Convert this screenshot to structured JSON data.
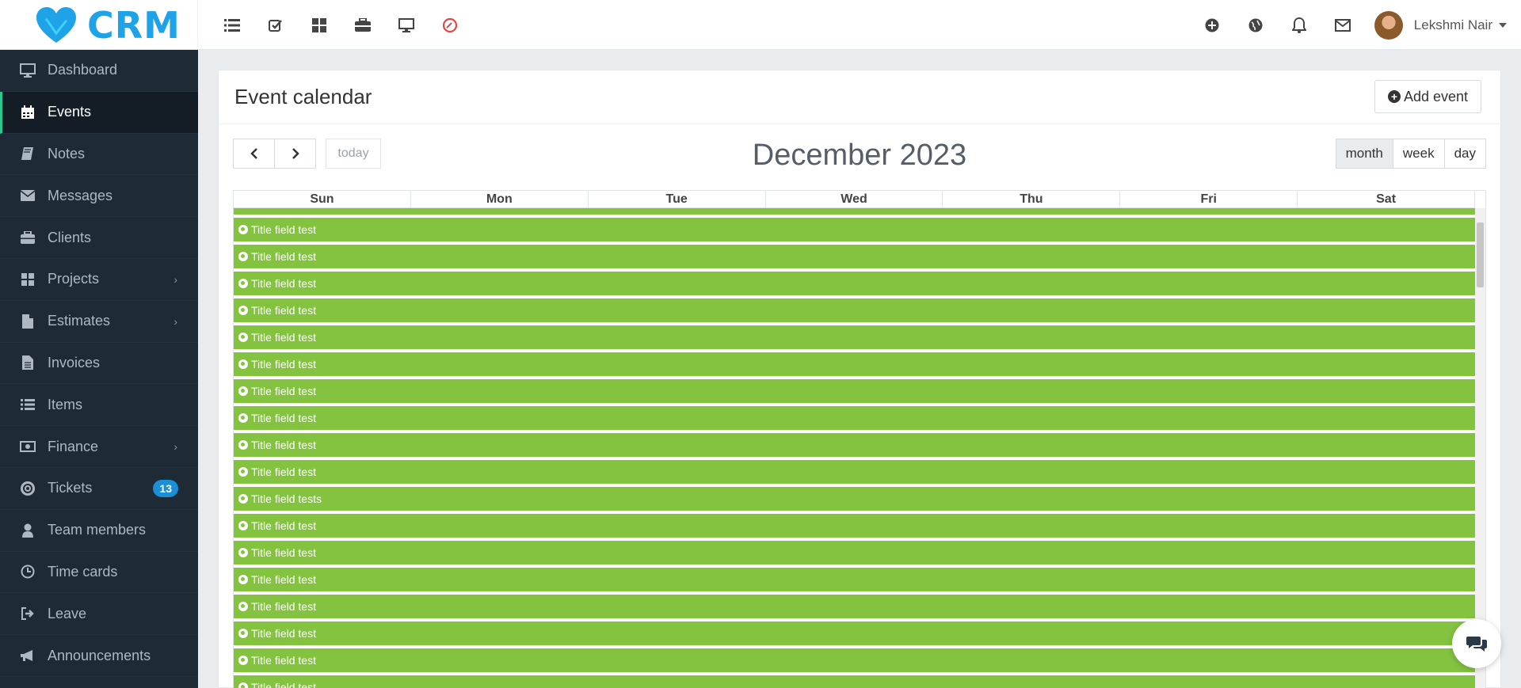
{
  "app": {
    "logo_text": "CRM"
  },
  "topbar": {
    "left_icons": [
      "list-icon",
      "check-square-icon",
      "grid-icon",
      "briefcase-icon",
      "monitor-icon",
      "clock-icon"
    ],
    "right_icons": [
      "plus-circle-icon",
      "globe-icon",
      "bell-icon",
      "envelope-icon"
    ],
    "user_name": "Lekshmi Nair"
  },
  "sidebar": {
    "items": [
      {
        "label": "Dashboard",
        "icon": "desktop-icon"
      },
      {
        "label": "Events",
        "icon": "calendar-icon",
        "active": true
      },
      {
        "label": "Notes",
        "icon": "book-icon"
      },
      {
        "label": "Messages",
        "icon": "envelope-icon"
      },
      {
        "label": "Clients",
        "icon": "briefcase-icon"
      },
      {
        "label": "Projects",
        "icon": "th-large-icon",
        "has_submenu": true
      },
      {
        "label": "Estimates",
        "icon": "file-icon",
        "has_submenu": true
      },
      {
        "label": "Invoices",
        "icon": "file-text-icon"
      },
      {
        "label": "Items",
        "icon": "list-icon"
      },
      {
        "label": "Finance",
        "icon": "money-icon",
        "has_submenu": true
      },
      {
        "label": "Tickets",
        "icon": "life-ring-icon",
        "badge": "13"
      },
      {
        "label": "Team members",
        "icon": "user-icon"
      },
      {
        "label": "Time cards",
        "icon": "clock-icon"
      },
      {
        "label": "Leave",
        "icon": "sign-out-icon"
      },
      {
        "label": "Announcements",
        "icon": "bullhorn-icon"
      }
    ]
  },
  "card": {
    "title": "Event calendar",
    "add_button_label": "Add event"
  },
  "calendar": {
    "today_label": "today",
    "title": "December 2023",
    "views": [
      {
        "label": "month",
        "active": true
      },
      {
        "label": "week"
      },
      {
        "label": "day"
      }
    ],
    "weekdays": [
      "Sun",
      "Mon",
      "Tue",
      "Wed",
      "Thu",
      "Fri",
      "Sat"
    ],
    "events": [
      "Title field test",
      "Title field test",
      "Title field test",
      "Title field test",
      "Title field test",
      "Title field test",
      "Title field test",
      "Title field test",
      "Title field test",
      "Title field test",
      "Title field test",
      "Title field tests",
      "Title field test",
      "Title field test",
      "Title field test",
      "Title field test",
      "Title field test",
      "Title field test",
      "Title field test"
    ]
  },
  "colors": {
    "event_green": "#83c340",
    "sidebar_bg": "#1e2a35",
    "accent_active": "#2ec78f",
    "badge_blue": "#1a8fd6",
    "logo_blue": "#1fa3e8"
  }
}
